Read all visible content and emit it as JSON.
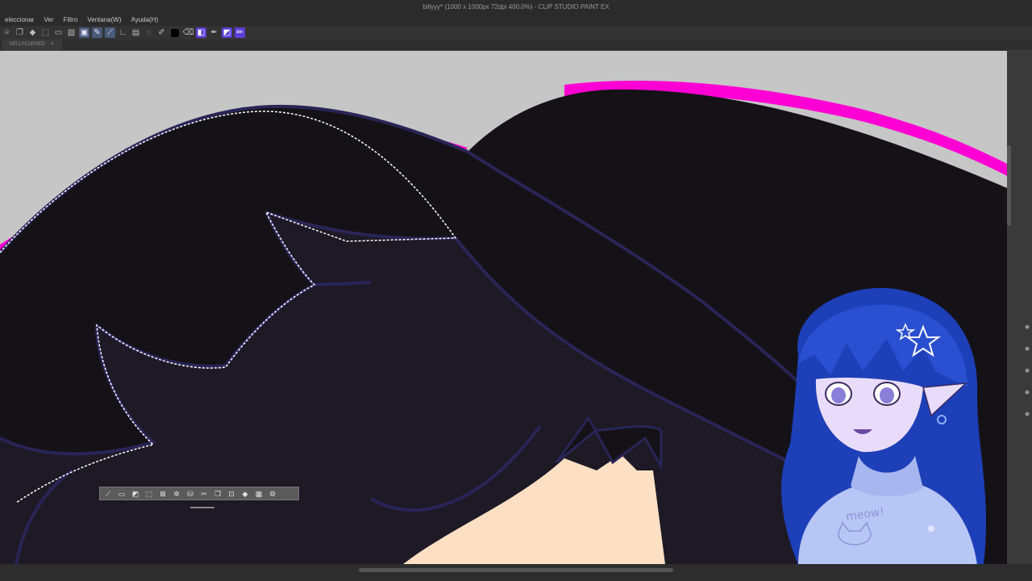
{
  "window": {
    "title": "billyyy* (1000 x 1000px 72dpi 400.0%) - CLIP STUDIO PAINT EX"
  },
  "menu": {
    "items": [
      "eleccionar",
      "Ver",
      "Filtro",
      "Ventana(W)",
      "Ayuda(H)"
    ]
  },
  "toolbar": {
    "buttons": [
      "lasso-icon",
      "copy-icon",
      "fill-icon",
      "transform-icon",
      "select-icon",
      "hatch-icon",
      "select-rect-icon",
      "pen-icon",
      "line-icon",
      "layer-icon",
      "clip-icon",
      "brush-icon",
      "color-black",
      "eraser-icon",
      "select-active-icon",
      "eyedrop-icon",
      "blend-icon",
      "pen-purple-icon"
    ]
  },
  "tab": {
    "label": "KELLYCURSED",
    "close": "×"
  },
  "selection_launcher": {
    "buttons": [
      "select-cancel-icon",
      "select-all-icon",
      "select-invert-icon",
      "select-expand-icon",
      "select-shrink-icon",
      "select-transform-icon",
      "select-fill-icon",
      "select-clear-icon",
      "select-copy-icon",
      "select-cut-icon",
      "select-mask-icon",
      "select-more-icon",
      "select-settings-icon"
    ]
  },
  "overlay": {
    "meow_text": "meow!"
  },
  "colors": {
    "canvas_bg": "#c6c6c6",
    "hair": "#141217",
    "shadow": "#1d1a26",
    "lineart": "#2a2557",
    "magenta": "#ff00d4",
    "skin": "#fde0c4",
    "avatar_hair": "#1d3fb8",
    "avatar_sweater": "#b8c6f5"
  }
}
